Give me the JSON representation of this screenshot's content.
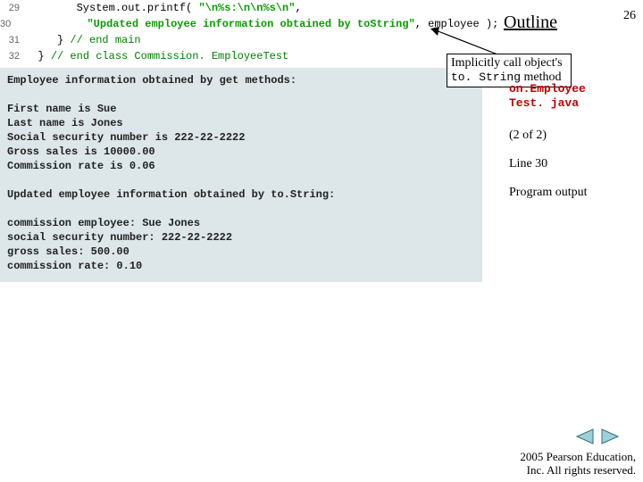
{
  "pageNumber": "26",
  "outlineTitle": "Outline",
  "code": {
    "lines": [
      {
        "num": "29",
        "segments": [
          {
            "cls": "tok-plain",
            "t": "        System.out.printf( "
          },
          {
            "cls": "tok-str",
            "t": "\"\\n%s:\\n\\n%s\\n\""
          },
          {
            "cls": "tok-plain",
            "t": ","
          }
        ]
      },
      {
        "num": "30",
        "segments": [
          {
            "cls": "tok-plain",
            "t": "           "
          },
          {
            "cls": "tok-str",
            "t": "\"Updated employee information obtained by toString\""
          },
          {
            "cls": "tok-plain",
            "t": ", employee );"
          }
        ]
      },
      {
        "num": "31",
        "segments": [
          {
            "cls": "tok-plain",
            "t": "     } "
          },
          {
            "cls": "tok-comment",
            "t": "// end main"
          }
        ]
      },
      {
        "num": "32",
        "segments": [
          {
            "cls": "tok-plain",
            "t": "  } "
          },
          {
            "cls": "tok-comment",
            "t": "// end class Commission. EmployeeTest"
          }
        ]
      }
    ]
  },
  "output": [
    "Employee information obtained by get methods:",
    "",
    "First name is Sue",
    "Last name is Jones",
    "Social security number is 222-22-2222",
    "Gross sales is 10000.00",
    "Commission rate is 0.06",
    "",
    "Updated employee information obtained by to.String:",
    "",
    "commission employee: Sue Jones",
    "social security number: 222-22-2222",
    "gross sales: 500.00",
    "commission rate: 0.10"
  ],
  "callout": {
    "line1": "Implicitly call object's",
    "mono": "to. String",
    "line2": " method"
  },
  "fileLabel": {
    "line1": "on.Employee",
    "line2": "Test. java"
  },
  "sideNotes": {
    "a": "(2 of 2)",
    "b": "Line 30",
    "c": "Program output"
  },
  "copyright": {
    "line1": "  2005 Pearson Education,",
    "line2": "Inc. All rights reserved."
  }
}
